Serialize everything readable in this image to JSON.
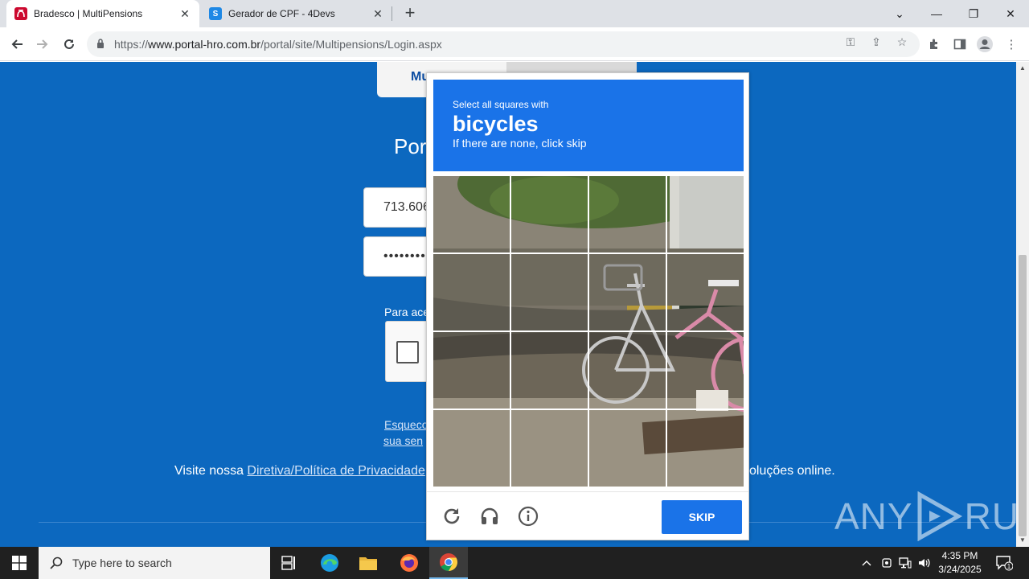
{
  "browser": {
    "tabs": [
      {
        "title": "Bradesco | MultiPensions",
        "active": true,
        "favicon_color": "#cc092f"
      },
      {
        "title": "Gerador de CPF - 4Devs",
        "active": false,
        "favicon_color": "#1e88e5"
      }
    ],
    "new_tab": "+",
    "url_scheme": "https://",
    "url_host": "www.portal-hro.com.br",
    "url_path": "/portal/site/Multipensions/Login.aspx"
  },
  "page": {
    "tab_label": "Mu",
    "portal_title": "Por",
    "cpf_value": "713.606",
    "password_mask": "•••••••••",
    "para_acessar": "Para ace",
    "forgot_line1": "Esqueco",
    "forgot_line2": "sua sen",
    "visit_prefix": "Visite nossa ",
    "visit_link": "Diretiva/Política de Privacidade",
    "visit_suffix": "oluções online.",
    "bg_color": "#0c68bf"
  },
  "captcha": {
    "instruction": "Select all squares with",
    "target": "bicycles",
    "hint": "If there are none, click skip",
    "skip_label": "SKIP",
    "icons": [
      "reload-icon",
      "audio-icon",
      "info-icon"
    ],
    "accent_color": "#1a73e8"
  },
  "watermark": {
    "left": "ANY",
    "right": "RUN"
  },
  "taskbar": {
    "search_placeholder": "Type here to search",
    "time": "4:35 PM",
    "date": "3/24/2025",
    "notification_count": "1"
  }
}
